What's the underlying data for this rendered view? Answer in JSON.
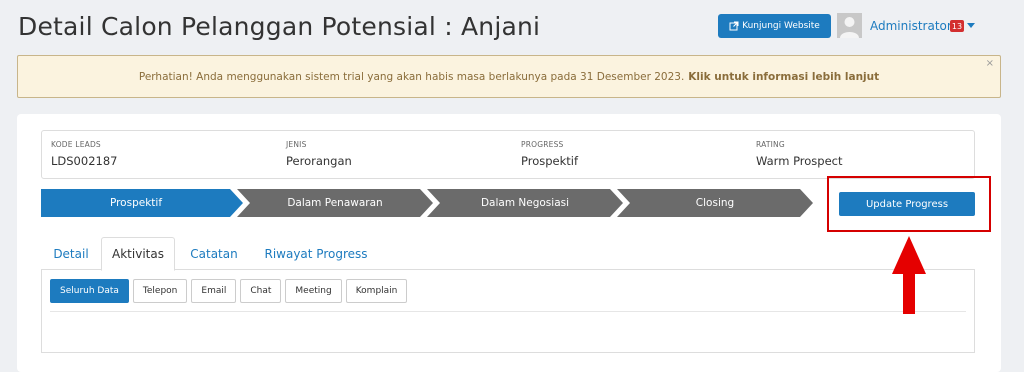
{
  "page": {
    "title": "Detail Calon Pelanggan Potensial : Anjani"
  },
  "header": {
    "visit_website_label": "Kunjungi Website",
    "user_name": "Administrator",
    "notification_count": "13"
  },
  "alert": {
    "message": "Perhatian! Anda menggunakan sistem trial yang akan habis masa berlakunya pada 31 Desember 2023.",
    "link_text": "Klik untuk informasi lebih lanjut",
    "close_symbol": "×"
  },
  "info": {
    "kode_leads": {
      "label": "KODE LEADS",
      "value": "LDS002187"
    },
    "jenis": {
      "label": "JENIS",
      "value": "Perorangan"
    },
    "progress": {
      "label": "PROGRESS",
      "value": "Prospektif"
    },
    "rating": {
      "label": "RATING",
      "value": "Warm Prospect"
    }
  },
  "stages": {
    "items": [
      "Prospektif",
      "Dalam Penawaran",
      "Dalam Negosiasi",
      "Closing"
    ],
    "active_index": 0,
    "active_color": "#1d7bbf",
    "inactive_color": "#6b6b6b"
  },
  "update_button": {
    "label": "Update Progress"
  },
  "tabs": {
    "items": [
      "Detail",
      "Aktivitas",
      "Catatan",
      "Riwayat Progress"
    ],
    "active_index": 1
  },
  "filters": {
    "items": [
      "Seluruh Data",
      "Telepon",
      "Email",
      "Chat",
      "Meeting",
      "Komplain"
    ],
    "active_index": 0
  },
  "colors": {
    "primary": "#1d7bbf",
    "highlight": "#d50000",
    "alert_bg": "#fbf3df"
  }
}
